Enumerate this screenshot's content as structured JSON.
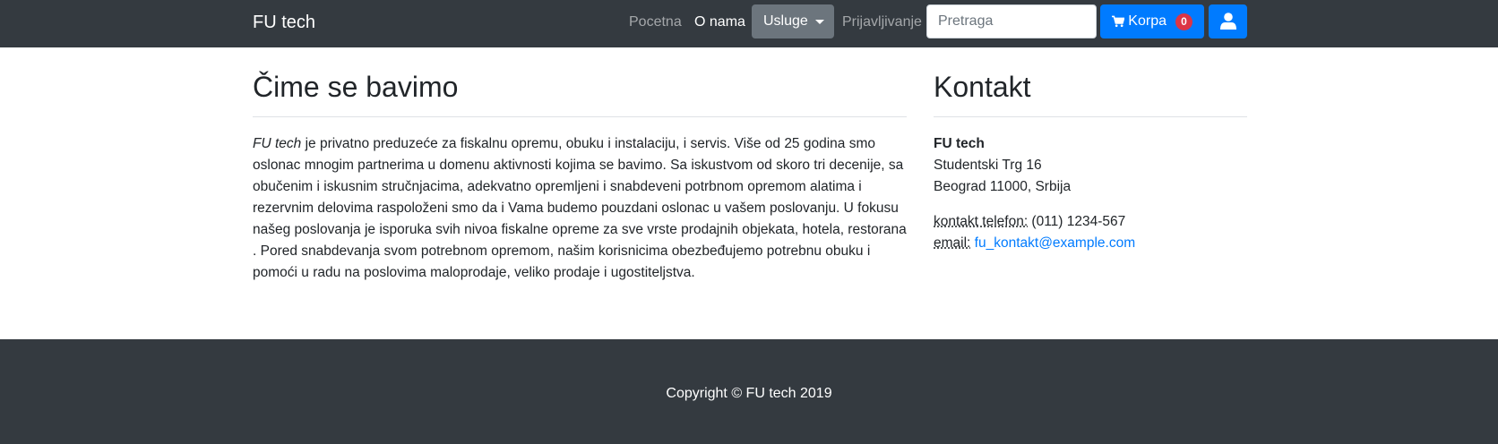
{
  "navbar": {
    "brand": "FU tech",
    "links": {
      "home": "Pocetna",
      "about": "O nama",
      "login": "Prijavljivanje"
    },
    "services_dropdown": "Usluge",
    "search_placeholder": "Pretraga",
    "cart": {
      "label": "Korpa",
      "count": "0"
    }
  },
  "about": {
    "title": "Čime se bavimo",
    "company_em": "FU tech",
    "text": " je privatno preduzeće za fiskalnu opremu, obuku i instalaciju, i servis. Više od 25 godina smo oslonac mnogim partnerima u domenu aktivnosti kojima se bavimo. Sa iskustvom od skoro tri decenije, sa obučenim i iskusnim stručnjacima, adekvatno opremljeni i snabdeveni potrbnom opremom alatima i rezervnim delovima raspoloženi smo da i Vama budemo pouzdani oslonac u vašem poslovanju. U fokusu našeg poslovanja je isporuka svih nivoa fiskalne opreme za sve vrste prodajnih objekata, hotela, restorana . Pored snabdevanja svom potrebnom opremom, našim korisnicima obezbeđujemo potrebnu obuku i pomoći u radu na poslovima maloprodaje, veliko prodaje i ugostiteljstva."
  },
  "contact": {
    "title": "Kontakt",
    "company": "FU tech",
    "street": "Studentski Trg 16",
    "city": "Beograd 11000, Srbija",
    "phone_label": "kontakt telefon:",
    "phone": " (011) 1234-567",
    "email_label": "email:",
    "email": "fu_kontakt@example.com"
  },
  "footer": {
    "copyright": "Copyright © FU tech 2019"
  },
  "colors": {
    "navbar_bg": "#343a40",
    "primary": "#007bff",
    "secondary": "#6c757d",
    "badge": "#dc3545"
  }
}
